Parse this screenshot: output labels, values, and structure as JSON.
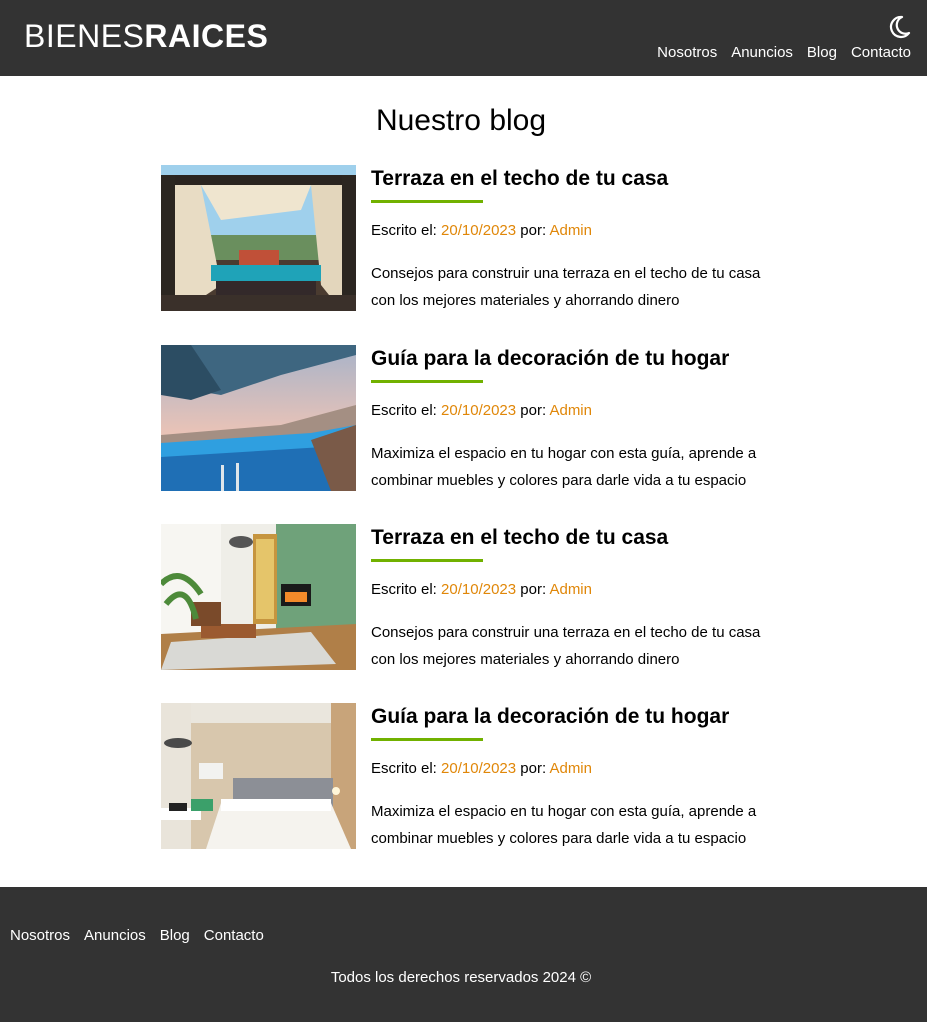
{
  "header": {
    "logo_light": "BIENES",
    "logo_bold": "RAICES",
    "theme_icon": "moon-icon",
    "nav": [
      "Nosotros",
      "Anuncios",
      "Blog",
      "Contacto"
    ]
  },
  "main": {
    "title": "Nuestro blog",
    "entries": [
      {
        "title": "Terraza en el techo de tu casa",
        "meta_prefix": "Escrito el: ",
        "date": "20/10/2023",
        "by": " por: ",
        "author": "Admin",
        "description": "Consejos para construir una terraza en el techo de tu casa con los mejores materiales y ahorrando dinero",
        "image": "rooftop-terrace-photo"
      },
      {
        "title": "Guía para la decoración de tu hogar",
        "meta_prefix": "Escrito el: ",
        "date": "20/10/2023",
        "by": " por: ",
        "author": "Admin",
        "description": "Maximiza el espacio en tu hogar con esta guía, aprende a combinar muebles y colores para darle vida a tu espacio",
        "image": "infinity-pool-photo"
      },
      {
        "title": "Terraza en el techo de tu casa",
        "meta_prefix": "Escrito el: ",
        "date": "20/10/2023",
        "by": " por: ",
        "author": "Admin",
        "description": "Consejos para construir una terraza en el techo de tu casa con los mejores materiales y ahorrando dinero",
        "image": "living-room-photo"
      },
      {
        "title": "Guía para la decoración de tu hogar",
        "meta_prefix": "Escrito el: ",
        "date": "20/10/2023",
        "by": " por: ",
        "author": "Admin",
        "description": "Maximiza el espacio en tu hogar con esta guía, aprende a combinar muebles y colores para darle vida a tu espacio",
        "image": "bedroom-photo"
      }
    ]
  },
  "footer": {
    "nav": [
      "Nosotros",
      "Anuncios",
      "Blog",
      "Contacto"
    ],
    "copyright": "Todos los derechos reservados 2024 ©"
  },
  "colors": {
    "header_bg": "#333333",
    "accent_green": "#71b100",
    "accent_orange": "#e08709"
  }
}
